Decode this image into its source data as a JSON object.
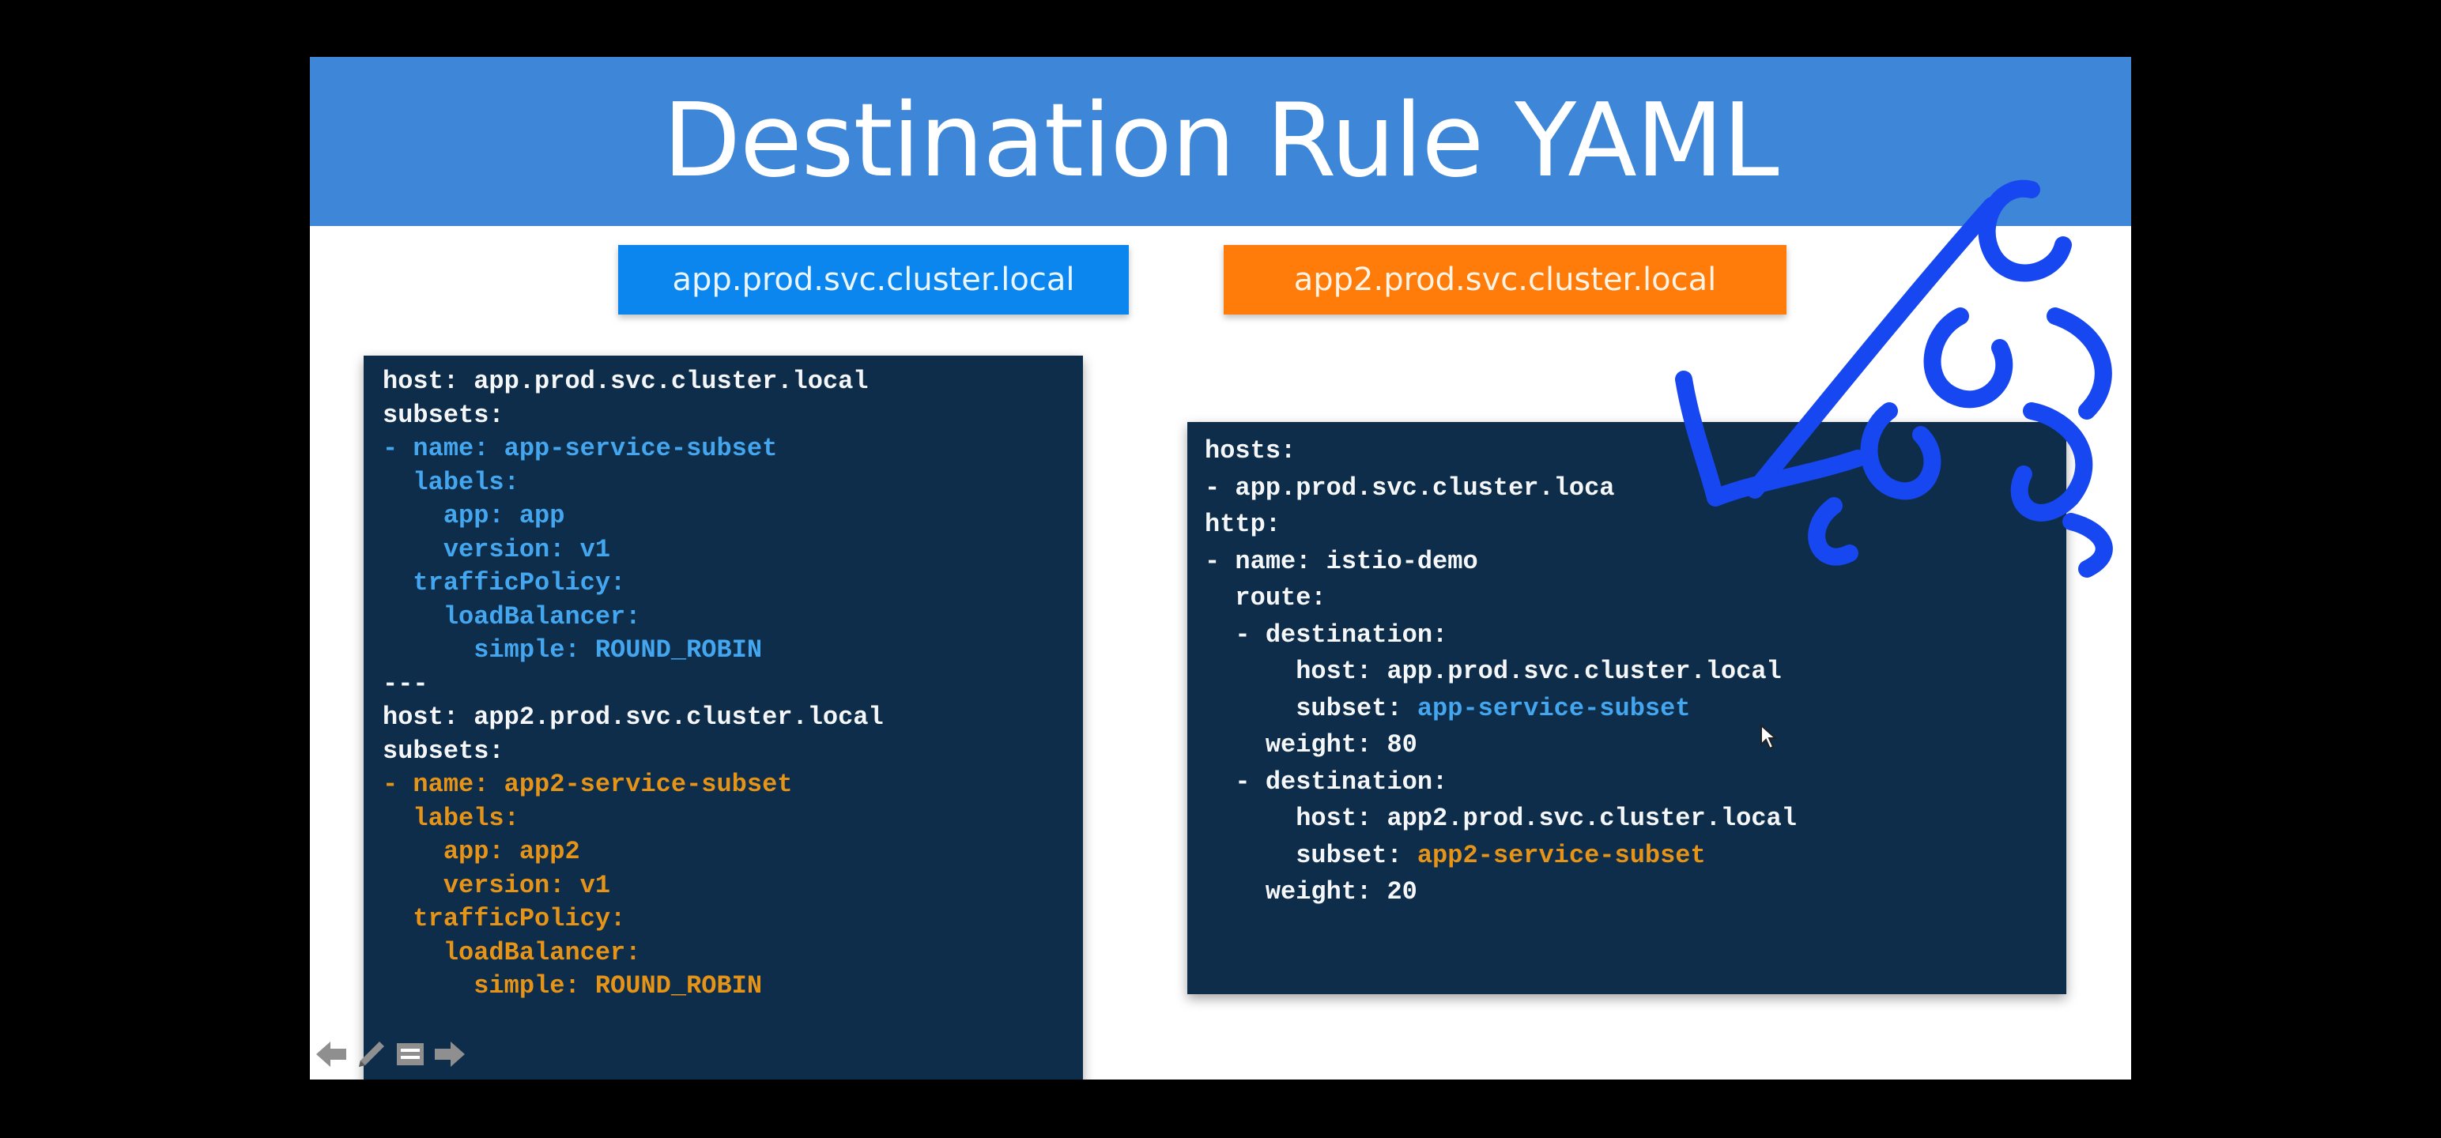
{
  "slide": {
    "title": "Destination Rule YAML",
    "host_labels": [
      {
        "text": "app.prod.svc.cluster.local",
        "color": "#0a86ee"
      },
      {
        "text": "app2.prod.svc.cluster.local",
        "color": "#ff7c0a"
      }
    ],
    "destination_rule_lines": [
      {
        "text": "host: app.prod.svc.cluster.local",
        "tone": "white"
      },
      {
        "text": "subsets:",
        "tone": "white"
      },
      {
        "text": "- name: app-service-subset",
        "tone": "blue"
      },
      {
        "text": "  labels:",
        "tone": "blue"
      },
      {
        "text": "    app: app",
        "tone": "blue"
      },
      {
        "text": "    version: v1",
        "tone": "blue"
      },
      {
        "text": "  trafficPolicy:",
        "tone": "blue"
      },
      {
        "text": "    loadBalancer:",
        "tone": "blue"
      },
      {
        "text": "      simple: ROUND_ROBIN",
        "tone": "blue"
      },
      {
        "text": "---",
        "tone": "white"
      },
      {
        "text": "host: app2.prod.svc.cluster.local",
        "tone": "white"
      },
      {
        "text": "subsets:",
        "tone": "white"
      },
      {
        "text": "- name: app2-service-subset",
        "tone": "orange"
      },
      {
        "text": "  labels:",
        "tone": "orange"
      },
      {
        "text": "    app: app2",
        "tone": "orange"
      },
      {
        "text": "    version: v1",
        "tone": "orange"
      },
      {
        "text": "  trafficPolicy:",
        "tone": "orange"
      },
      {
        "text": "    loadBalancer:",
        "tone": "orange"
      },
      {
        "text": "      simple: ROUND_ROBIN",
        "tone": "orange"
      }
    ],
    "virtual_service_lines": [
      {
        "prefix": "hosts:",
        "value": "",
        "tone": "white"
      },
      {
        "prefix": "- app.prod.svc.cluster.loca",
        "value": "",
        "tone": "white"
      },
      {
        "prefix": "http:",
        "value": "",
        "tone": "white"
      },
      {
        "prefix": "- name: istio-demo",
        "value": "",
        "tone": "white"
      },
      {
        "prefix": "  route:",
        "value": "",
        "tone": "white"
      },
      {
        "prefix": "  - destination:",
        "value": "",
        "tone": "white"
      },
      {
        "prefix": "      host: app.prod.svc.cluster.local",
        "value": "",
        "tone": "white"
      },
      {
        "prefix": "      subset: ",
        "value": "app-service-subset",
        "tone": "blue"
      },
      {
        "prefix": "    weight: 80",
        "value": "",
        "tone": "white"
      },
      {
        "prefix": "  - destination:",
        "value": "",
        "tone": "white"
      },
      {
        "prefix": "      host: app2.prod.svc.cluster.local",
        "value": "",
        "tone": "white"
      },
      {
        "prefix": "      subset: ",
        "value": "app2-service-subset",
        "tone": "orange"
      },
      {
        "prefix": "    weight: 20",
        "value": "",
        "tone": "white"
      }
    ],
    "toolbar": {
      "icons": [
        "back-arrow-icon",
        "pen-icon",
        "slides-menu-icon",
        "forward-arrow-icon"
      ]
    },
    "colors": {
      "title_bar": "#3d86d8",
      "code_background": "#0d2d4b",
      "code_blue": "#44a6ee",
      "code_orange": "#e69418",
      "annotation_ink": "#1747f0"
    }
  }
}
